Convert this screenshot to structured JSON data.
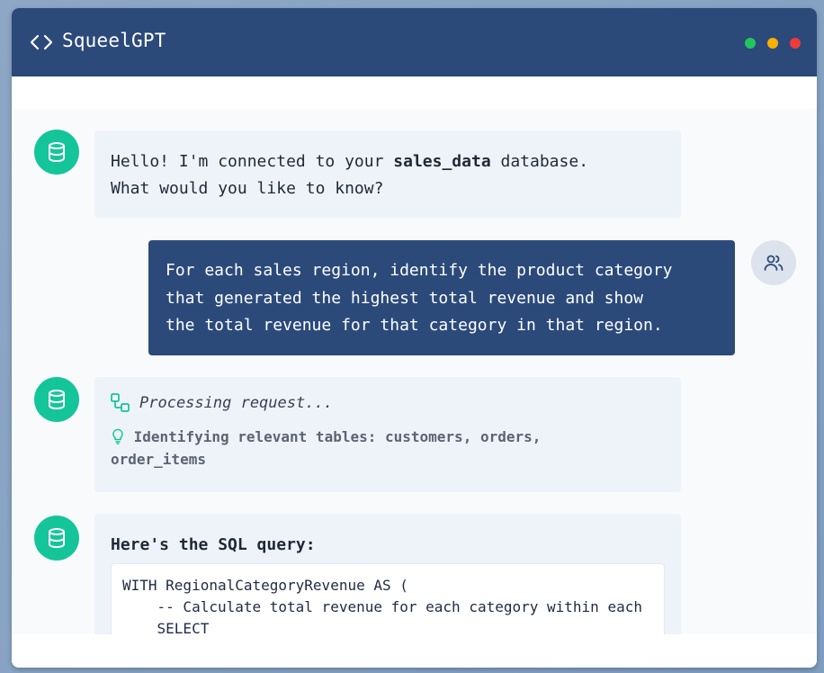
{
  "app": {
    "title": "SqueelGPT"
  },
  "window_controls": {
    "colors": [
      "#22c55e",
      "#f5b000",
      "#ef3b3b"
    ]
  },
  "messages": {
    "greeting": {
      "prefix": "Hello! I'm connected to your ",
      "db_name": "sales_data",
      "suffix": " database.",
      "line2": "What would you like to know?"
    },
    "user_query": {
      "lines": [
        "For each sales region, identify the product category",
        "that generated the highest total revenue and show",
        "the total revenue for that category in that region."
      ]
    },
    "processing": {
      "status": "Processing request...",
      "identify_line1": "Identifying relevant tables: customers, orders,",
      "identify_line2": "order_items"
    },
    "sql": {
      "heading": "Here's the SQL query:",
      "code": "WITH RegionalCategoryRevenue AS (\n    -- Calculate total revenue for each category within each\n    SELECT"
    }
  },
  "icons": {
    "header": "code-brackets-icon",
    "bot": "database-icon",
    "user": "users-icon",
    "processing": "workflow-icon",
    "hint": "lightbulb-icon"
  }
}
